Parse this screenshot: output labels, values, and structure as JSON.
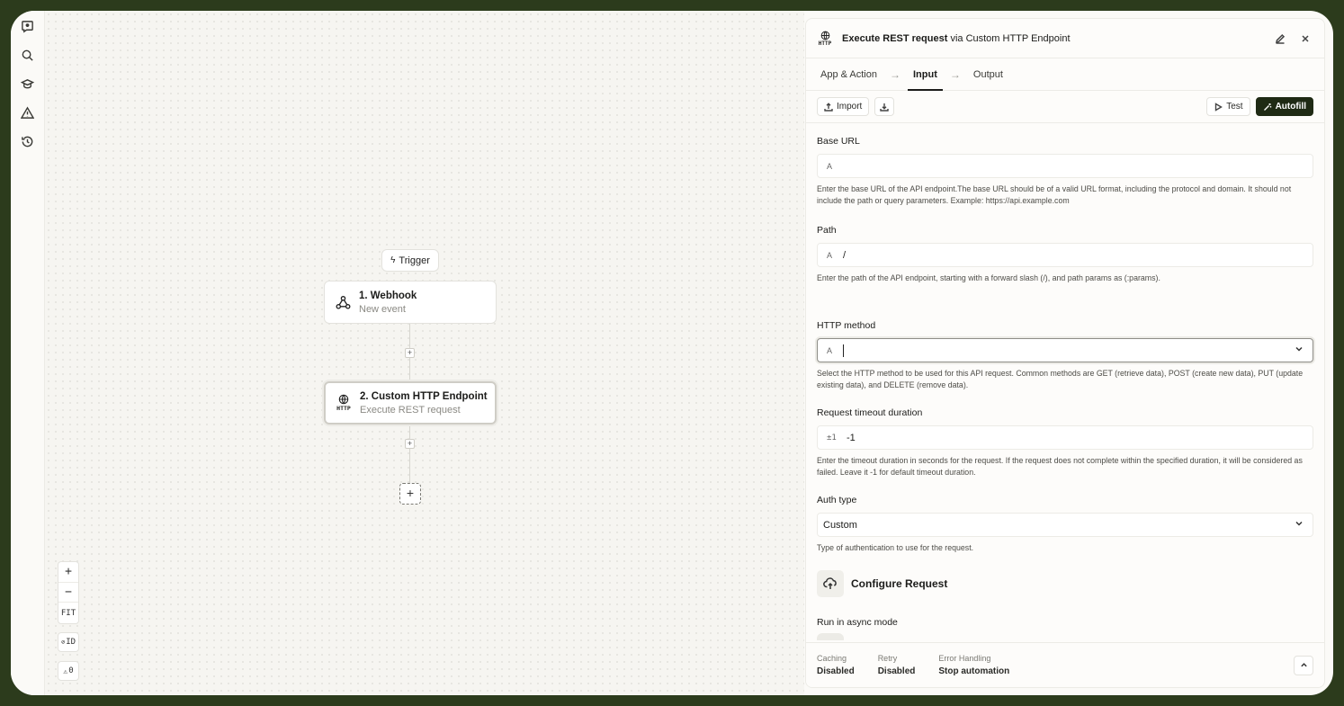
{
  "rail": {
    "icons": [
      "logo-icon",
      "search-icon",
      "graduation-cap-icon",
      "warning-icon",
      "history-icon"
    ]
  },
  "canvas": {
    "trigger_label": "Trigger",
    "nodes": [
      {
        "title": "1. Webhook",
        "subtitle": "New event",
        "icon": "webhook-icon"
      },
      {
        "title": "2. Custom HTTP Endpoint",
        "subtitle": "Execute REST request",
        "icon": "http-globe-icon",
        "icon_text": "HTTP"
      }
    ],
    "zoom": {
      "in": "+",
      "out": "−",
      "fit": "FIT",
      "id_toggle": "ID",
      "warnings": "0"
    }
  },
  "panel": {
    "title_bold": "Execute REST request",
    "title_via": "via",
    "title_app": "Custom HTTP Endpoint",
    "header_icon_text": "HTTP",
    "tabs": [
      "App & Action",
      "Input",
      "Output"
    ],
    "active_tab": "Input",
    "toolbar": {
      "import": "Import",
      "test": "Test",
      "autofill": "Autofill"
    },
    "fields": [
      {
        "label": "Base URL",
        "value": "",
        "type_icon": "A",
        "help": "Enter the base URL of the API endpoint.The base URL should be of a valid URL format, including the protocol and domain. It should not include the path or query parameters. Example: https://api.example.com"
      },
      {
        "label": "Path",
        "value": "/",
        "type_icon": "A",
        "help": "Enter the path of the API endpoint, starting with a forward slash (/), and path params as (:params)."
      },
      {
        "label": "HTTP method",
        "value": "",
        "type_icon": "A",
        "help": "Select the HTTP method to be used for this API request. Common methods are GET (retrieve data), POST (create new data), PUT (update existing data), and DELETE (remove data)."
      },
      {
        "label": "Request timeout duration",
        "value": "-1",
        "type_icon": "±1",
        "help": "Enter the timeout duration in seconds for the request. If the request does not complete within the specified duration, it will be considered as failed. Leave it -1 for default timeout duration."
      },
      {
        "label": "Auth type",
        "value": "Custom",
        "help": "Type of authentication to use for the request."
      }
    ],
    "configure_label": "Configure Request",
    "async_label": "Run in async mode",
    "footer": {
      "caching_k": "Caching",
      "caching_v": "Disabled",
      "retry_k": "Retry",
      "retry_v": "Disabled",
      "error_k": "Error Handling",
      "error_v": "Stop automation"
    }
  }
}
